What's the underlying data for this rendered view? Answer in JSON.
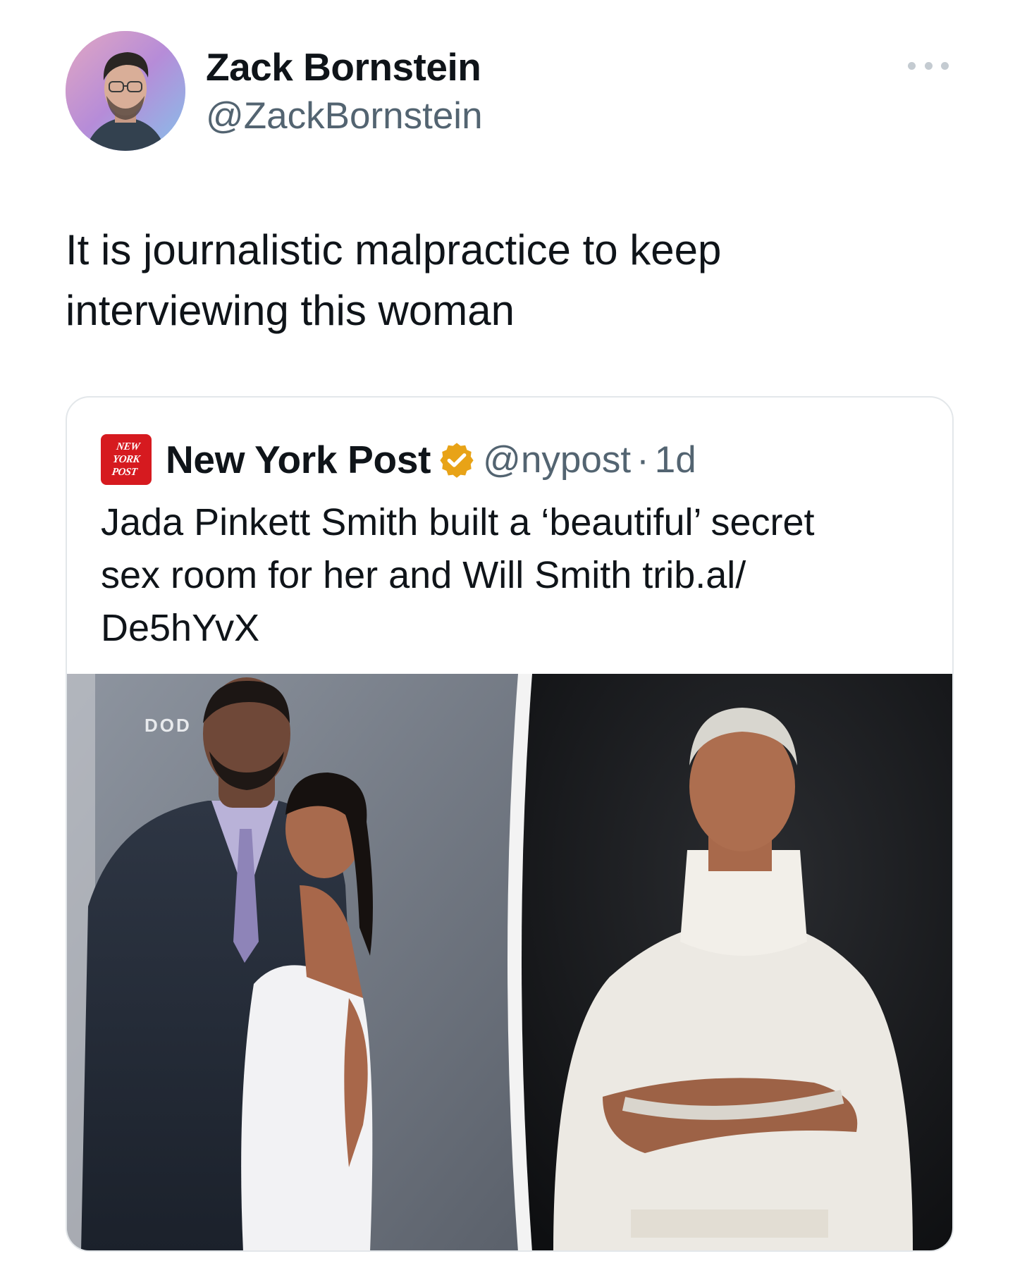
{
  "tweet": {
    "author": {
      "name": "Zack Bornstein",
      "handle": "@ZackBornstein"
    },
    "more_icon": "more-horizontal-icon",
    "text_lines": [
      "It is journalistic malpractice to keep",
      "interviewing this woman"
    ]
  },
  "quoted_tweet": {
    "author": {
      "name": "New York Post",
      "handle": "@nypost",
      "verified_icon": "verified-gold-badge-icon",
      "logo_lines": [
        "NEW",
        "YORK",
        "POST"
      ]
    },
    "separator": "·",
    "time": "1d",
    "text_lines": [
      "Jada Pinkett Smith built a ‘beautiful’ secret",
      "sex room for her and Will Smith trib.al/",
      "De5hYvX"
    ],
    "media": {
      "left_backdrop_text": "DOD",
      "colors": {
        "backdrop": "#7f8691",
        "dark_background": "#141518"
      }
    }
  },
  "colors": {
    "text_primary": "#0f1419",
    "text_secondary": "#536471",
    "border": "#e3e7ea",
    "brand_red": "#d61a1f",
    "badge_gold": "#e8a317"
  }
}
